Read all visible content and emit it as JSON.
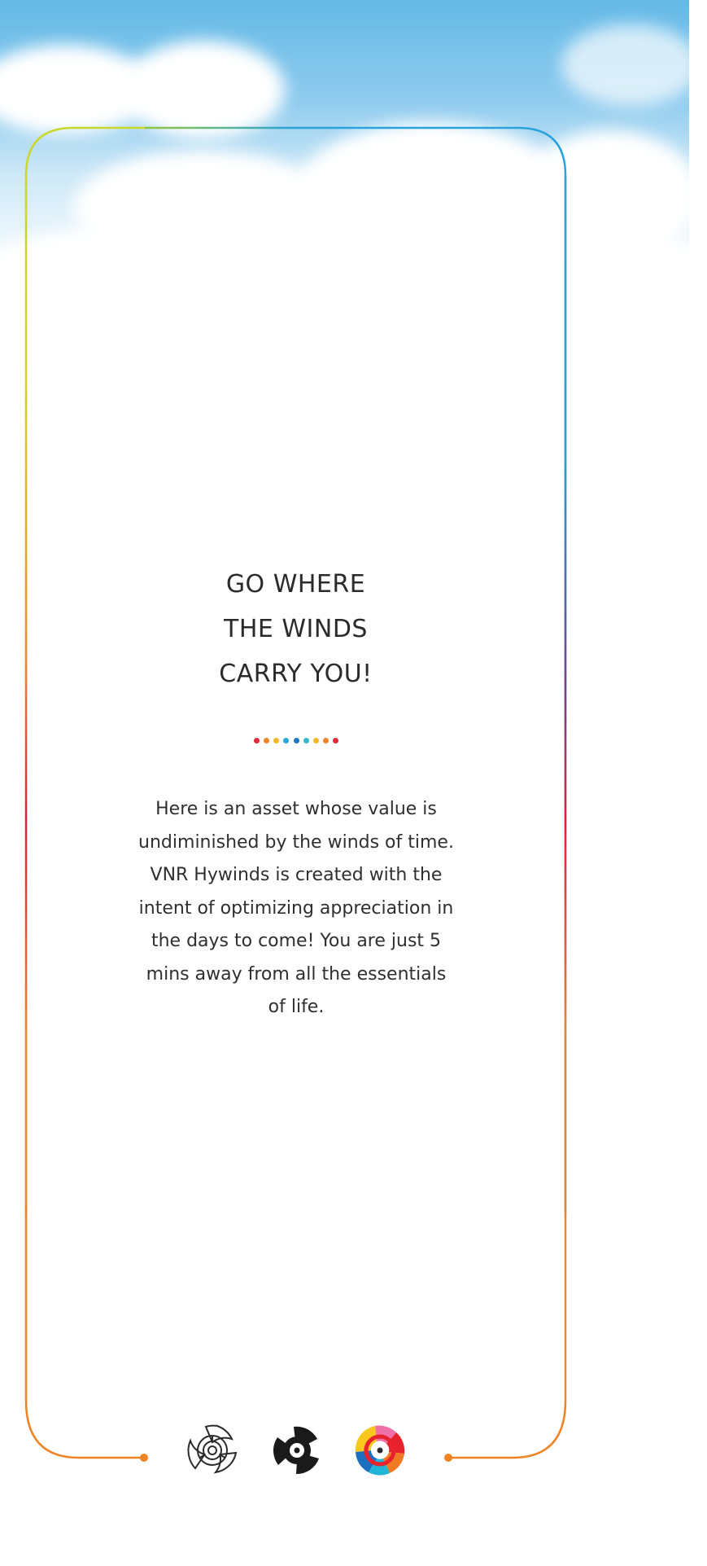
{
  "headline": {
    "lines": [
      "GO WHERE",
      "THE WINDS",
      "CARRY YOU!"
    ]
  },
  "divider": {
    "dot_colors": [
      "#e22b3a",
      "#f0862a",
      "#f5b82c",
      "#2aa6d8",
      "#1f78c2",
      "#34b8c9",
      "#f5b82c",
      "#f0862a",
      "#e22b3a"
    ]
  },
  "description": {
    "text": "Here is an asset whose value is undiminished by the winds of time. VNR Hywinds is created with the intent of optimizing appreciation in the days to come! You are just 5 mins away from all the essentials of life."
  },
  "logos": [
    "pinwheel-outline-icon",
    "pinwheel-black-icon",
    "pinwheel-color-icon"
  ],
  "colors": {
    "frame_top_left": "#c8d82b",
    "frame_top_right": "#2aa3dc",
    "frame_middle": "#e21f3b",
    "frame_bottom": "#f08324",
    "sky": "#64b9e6"
  }
}
